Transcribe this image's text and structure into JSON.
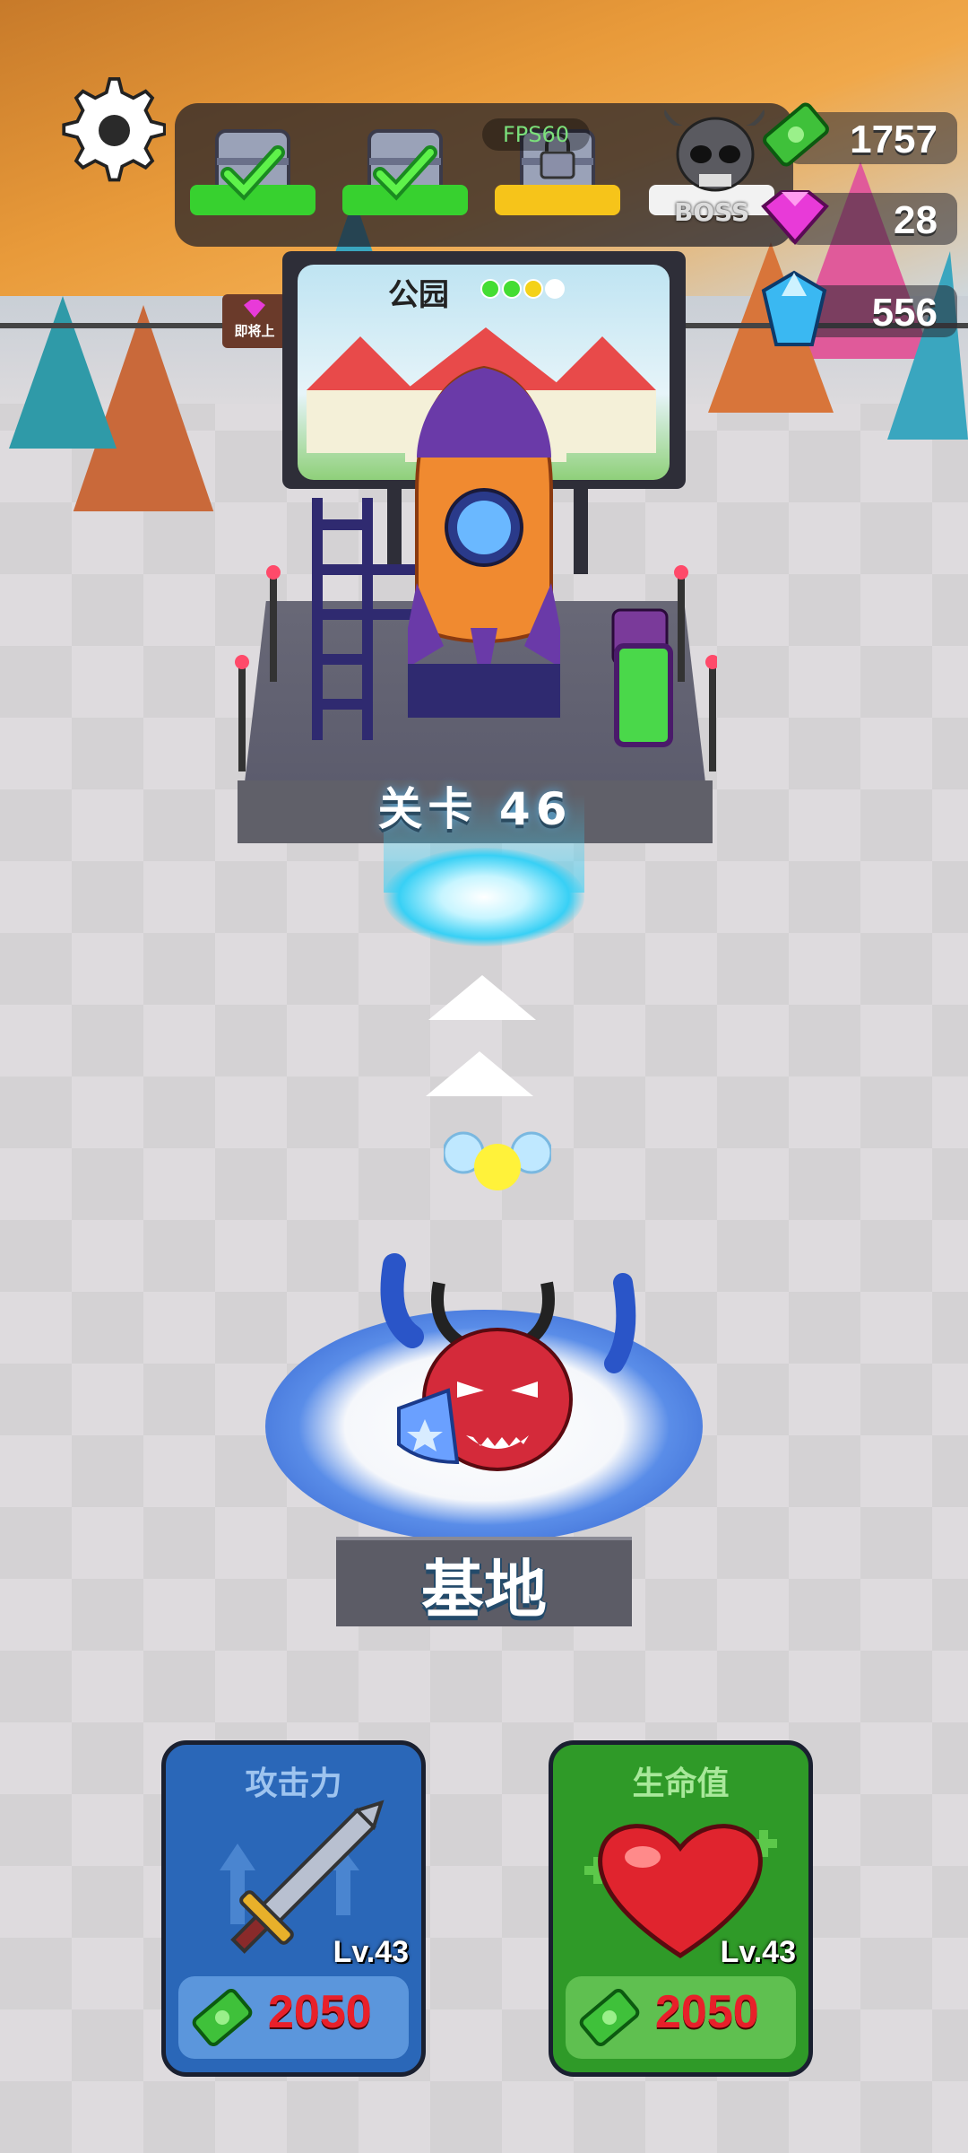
{
  "hud": {
    "fps_text": "FPS60",
    "boss_label": "BOSS",
    "stages": [
      {
        "state": "completed"
      },
      {
        "state": "completed"
      },
      {
        "state": "locked-current"
      },
      {
        "state": "boss"
      }
    ]
  },
  "currencies": {
    "cash": "1757",
    "pink_gems": "28",
    "blue_gems": "556"
  },
  "billboard": {
    "title": "公园",
    "progress_dots": [
      "#44dd33",
      "#44dd33",
      "#f4d21a",
      "#ffffff"
    ]
  },
  "side_sign": "即将上",
  "level": {
    "label": "关卡 46"
  },
  "base": {
    "label": "基地"
  },
  "upgrades": [
    {
      "title": "攻击力",
      "level": "Lv.43",
      "cost": "2050",
      "color": "#2a67b8"
    },
    {
      "title": "生命值",
      "level": "Lv.43",
      "cost": "2050",
      "color": "#2f9a28"
    }
  ],
  "colors": {
    "accent_red": "#e8202a",
    "check_green": "#37d12f",
    "progress_yellow": "#f6c41a"
  }
}
